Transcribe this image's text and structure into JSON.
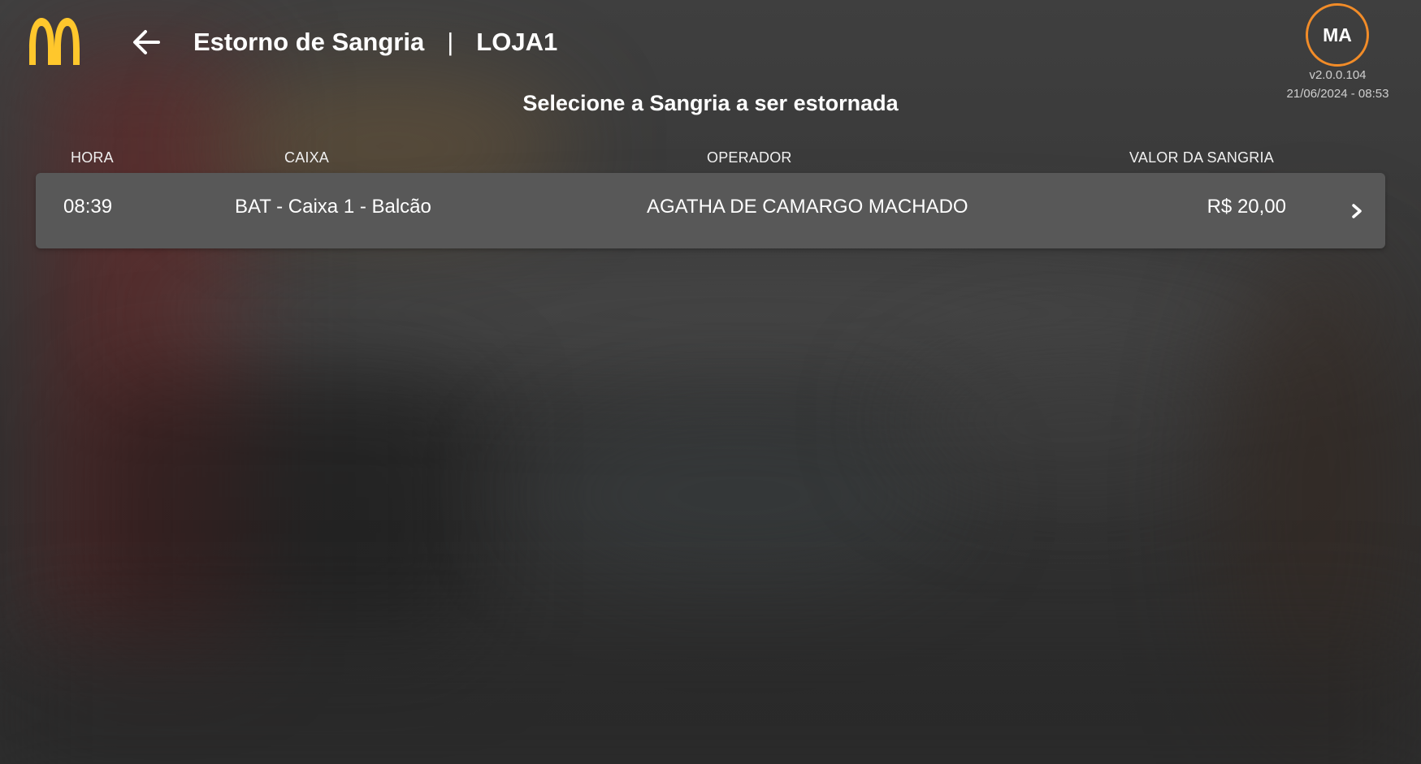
{
  "header": {
    "title": "Estorno de Sangria",
    "separator": "|",
    "store": "LOJA1"
  },
  "user": {
    "initials": "MA",
    "version": "v2.0.0.104",
    "datetime": "21/06/2024 - 08:53"
  },
  "subtitle": "Selecione a Sangria a ser estornada",
  "table": {
    "columns": [
      "HORA",
      "CAIXA",
      "OPERADOR",
      "VALOR DA SANGRIA"
    ],
    "rows": [
      {
        "hora": "08:39",
        "caixa": "BAT - Caixa 1 - Balcão",
        "operador": "AGATHA DE CAMARGO MACHADO",
        "valor": "R$ 20,00"
      }
    ]
  },
  "icons": {
    "logo": "mcdonalds-arches-logo",
    "back": "arrow-left-icon",
    "row_action": "chevron-right-icon"
  },
  "colors": {
    "logo_yellow": "#FFC72C",
    "avatar_ring": "#F28C28",
    "row_background": "#585858"
  }
}
